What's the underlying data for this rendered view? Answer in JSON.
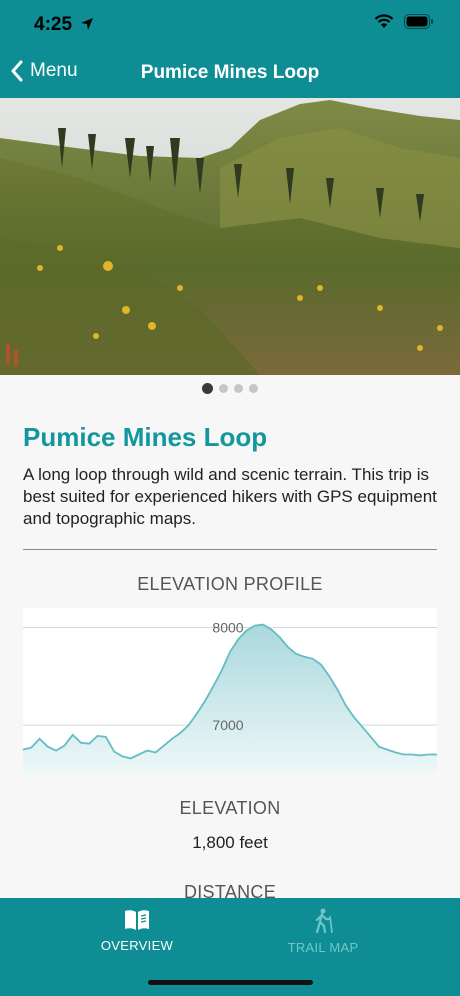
{
  "status_bar": {
    "time": "4:25"
  },
  "nav": {
    "back_label": "Menu",
    "title": "Pumice Mines Loop"
  },
  "carousel": {
    "page_count": 4,
    "current_page": 1
  },
  "trail": {
    "title": "Pumice Mines Loop",
    "description": "A long loop through wild and scenic terrain. This trip is best suited for experienced hikers with GPS equipment and topographic maps."
  },
  "elevation_profile": {
    "heading": "ELEVATION PROFILE"
  },
  "stats": {
    "elevation_label": "ELEVATION",
    "elevation_value": "1,800 feet",
    "distance_label": "DISTANCE"
  },
  "tabs": [
    {
      "label": "OVERVIEW",
      "icon": "book-icon",
      "active": true
    },
    {
      "label": "TRAIL MAP",
      "icon": "hiker-icon",
      "active": false
    }
  ],
  "colors": {
    "accent": "#0e8e94",
    "title": "#11979c",
    "chart_fill": "#bfe3e6",
    "chart_line": "#64bdc3"
  },
  "chart_data": {
    "type": "area",
    "title": "ELEVATION PROFILE",
    "xlabel": "",
    "ylabel": "",
    "y_ticks": [
      7000,
      8000
    ],
    "ylim": [
      6500,
      8200
    ],
    "x": [
      0,
      2,
      4,
      6,
      8,
      10,
      12,
      14,
      16,
      18,
      20,
      22,
      24,
      26,
      28,
      30,
      32,
      34,
      36,
      38,
      40,
      42,
      44,
      46,
      48,
      50,
      52,
      54,
      56,
      58,
      60,
      62,
      64,
      66,
      68,
      70,
      72,
      74,
      76,
      78,
      80,
      82,
      84,
      86,
      88,
      90,
      92,
      94,
      96,
      98,
      100
    ],
    "values": [
      6750,
      6770,
      6860,
      6780,
      6740,
      6790,
      6900,
      6820,
      6810,
      6890,
      6880,
      6730,
      6680,
      6660,
      6700,
      6740,
      6720,
      6790,
      6860,
      6920,
      7000,
      7120,
      7250,
      7400,
      7560,
      7750,
      7880,
      7970,
      8020,
      8030,
      7980,
      7900,
      7800,
      7730,
      7700,
      7680,
      7620,
      7500,
      7360,
      7200,
      7080,
      6980,
      6880,
      6780,
      6750,
      6720,
      6700,
      6700,
      6690,
      6700,
      6700
    ]
  }
}
